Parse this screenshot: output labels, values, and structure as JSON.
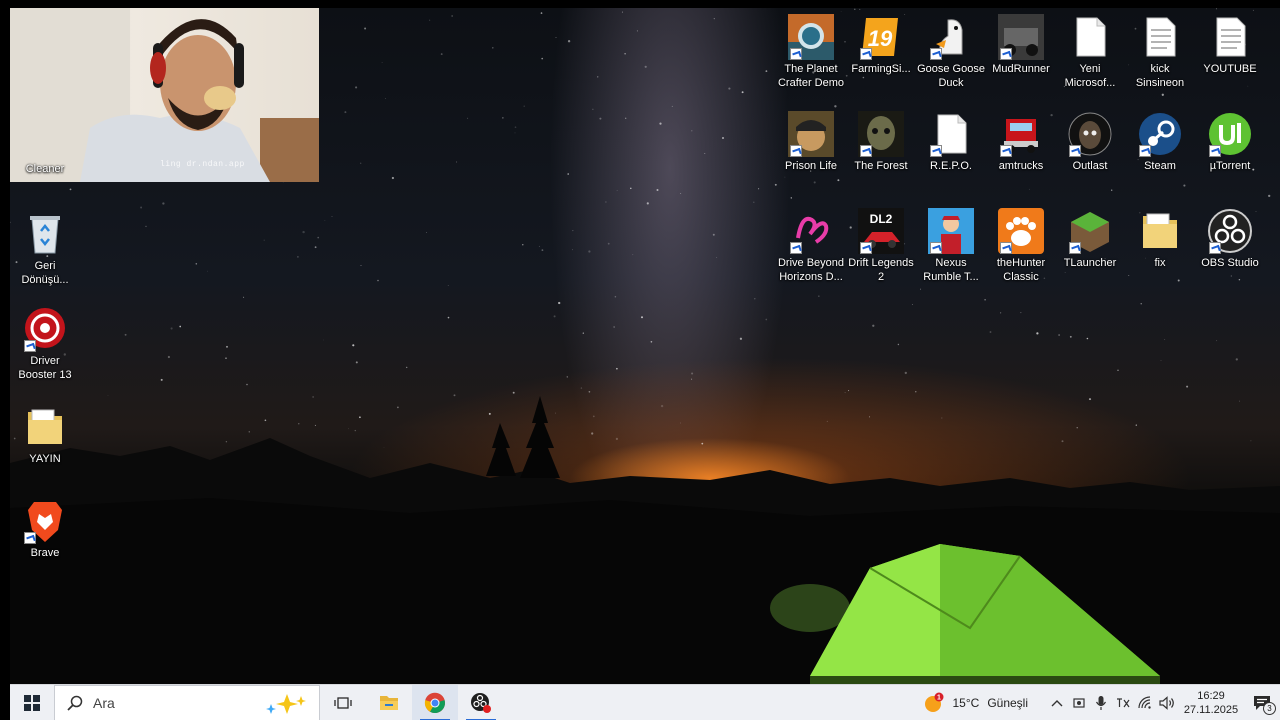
{
  "desktop": {
    "left_icons": [
      {
        "label": "Cleaner",
        "icon": "cleaner-icon"
      },
      {
        "label": "Geri\nDönüşü...",
        "icon": "recycle-bin-icon"
      },
      {
        "label": "Driver\nBooster 13",
        "icon": "driver-booster-icon"
      },
      {
        "label": "YAYIN",
        "icon": "folder-icon"
      },
      {
        "label": "Brave",
        "icon": "brave-browser-icon"
      }
    ],
    "right_icons_row1": [
      {
        "label": "The Planet\nCrafter Demo",
        "icon": "planet-crafter-icon"
      },
      {
        "label": "FarmingSi...",
        "icon": "farming-simulator-icon",
        "badge": "19"
      },
      {
        "label": "Goose Goose\nDuck",
        "icon": "goose-goose-duck-icon"
      },
      {
        "label": "MudRunner",
        "icon": "mudrunner-icon"
      },
      {
        "label": "Yeni\nMicrosof...",
        "icon": "document-icon"
      },
      {
        "label": "kick\nSinsineon",
        "icon": "document-icon"
      },
      {
        "label": "YOUTUBE",
        "icon": "document-icon"
      }
    ],
    "right_icons_row2": [
      {
        "label": "Prison Life",
        "icon": "prison-life-icon"
      },
      {
        "label": "The Forest",
        "icon": "the-forest-icon"
      },
      {
        "label": "R.E.P.O.",
        "icon": "document-icon"
      },
      {
        "label": "amtrucks",
        "icon": "american-truck-icon"
      },
      {
        "label": "Outlast",
        "icon": "outlast-icon"
      },
      {
        "label": "Steam",
        "icon": "steam-icon"
      },
      {
        "label": "µTorrent",
        "icon": "utorrent-icon"
      }
    ],
    "right_icons_row3": [
      {
        "label": "Drive Beyond\nHorizons D...",
        "icon": "drive-beyond-horizons-icon"
      },
      {
        "label": "Drift Legends\n2",
        "icon": "drift-legends-icon",
        "badge": "DL2"
      },
      {
        "label": "Nexus\nRumble T...",
        "icon": "nexus-rumble-icon"
      },
      {
        "label": "theHunter\nClassic",
        "icon": "thehunter-icon"
      },
      {
        "label": "TLauncher",
        "icon": "tlauncher-icon"
      },
      {
        "label": "fix",
        "icon": "folder-icon"
      },
      {
        "label": "OBS Studio",
        "icon": "obs-studio-icon"
      }
    ]
  },
  "webcam": {
    "watermark": "ling dr.ndan.app"
  },
  "taskbar": {
    "search_placeholder": "Ara",
    "apps": [
      {
        "name": "task-view",
        "icon": "task-view-icon"
      },
      {
        "name": "file-explorer",
        "icon": "folder-icon"
      },
      {
        "name": "chrome",
        "icon": "chrome-icon"
      },
      {
        "name": "obs",
        "icon": "obs-recording-icon"
      }
    ],
    "weather": {
      "temp": "15°C",
      "condition": "Güneşli",
      "alert_count": "1"
    },
    "clock": {
      "time": "16:29",
      "date": "27.11.2025"
    },
    "notification_count": "3"
  },
  "colors": {
    "taskbar_bg": "#eef0f4",
    "accent": "#2a6cd6",
    "label_text": "#ffffff"
  }
}
